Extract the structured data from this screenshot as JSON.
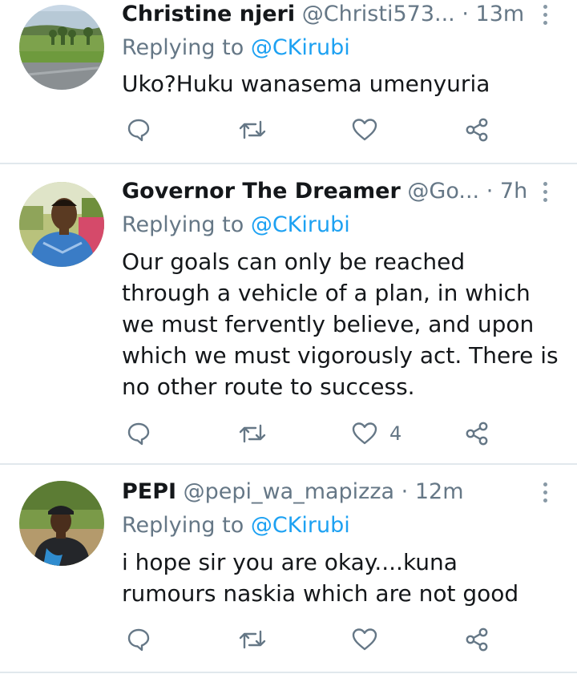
{
  "tweets": [
    {
      "name": "Christine njeri",
      "handle": "@Christi573...",
      "separator": "·",
      "time": "13m",
      "replying_prefix": "Replying to ",
      "replying_to": "@CKirubi",
      "text": "Uko?Huku wanasema umenyuria",
      "reply_count": "",
      "retweet_count": "",
      "like_count": ""
    },
    {
      "name": "Governor The Dreamer",
      "handle": "@Go...",
      "separator": "·",
      "time": "7h",
      "replying_prefix": "Replying to ",
      "replying_to": "@CKirubi",
      "text": "Our goals can only be reached through a vehicle of a plan, in which we must fervently believe, and upon which we must vigorously act. There is no other route to success.",
      "reply_count": "",
      "retweet_count": "",
      "like_count": "4"
    },
    {
      "name": "PEPI",
      "handle": "@pepi_wa_mapizza",
      "separator": "·",
      "time": "12m",
      "replying_prefix": "Replying to ",
      "replying_to": "@CKirubi",
      "text": "i hope sir you are okay....kuna rumours naskia  which are not good",
      "reply_count": "",
      "retweet_count": "",
      "like_count": ""
    }
  ],
  "icons": {
    "reply": "reply-icon",
    "retweet": "retweet-icon",
    "like": "heart-icon",
    "share": "share-icon",
    "more": "more-vertical-icon"
  },
  "colors": {
    "name": "#14171a",
    "secondary": "#657786",
    "mention": "#1da1f2",
    "icon": "#657786",
    "divider": "#e1e8ed"
  }
}
